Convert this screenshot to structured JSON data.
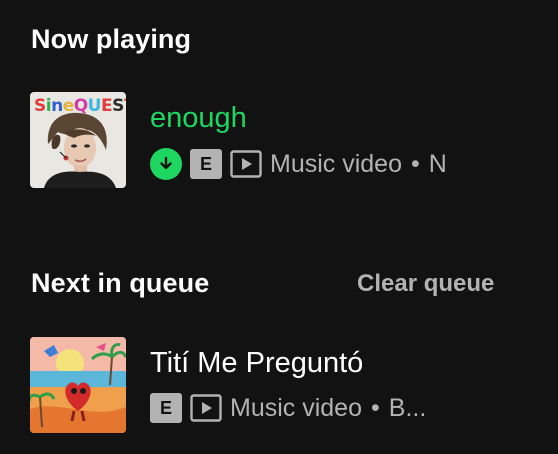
{
  "now_playing": {
    "heading": "Now playing",
    "track": {
      "title": "enough",
      "art_text": "SINEQUEST",
      "explicit_label": "E",
      "type": "Music video",
      "separator": "•",
      "artist_truncated": "N"
    }
  },
  "queue": {
    "heading": "Next in queue",
    "clear_label": "Clear queue",
    "tracks": [
      {
        "title": "Tití Me Preguntó",
        "explicit_label": "E",
        "type": "Music video",
        "separator": "•",
        "artist_truncated": "B..."
      }
    ]
  },
  "colors": {
    "background": "#121212",
    "accent_green": "#1ed760",
    "secondary_text": "#b3b3b3",
    "primary_text": "#ffffff"
  },
  "icons": {
    "downloaded": "download-check-icon",
    "explicit": "explicit-badge",
    "video": "play-rectangle-icon"
  }
}
